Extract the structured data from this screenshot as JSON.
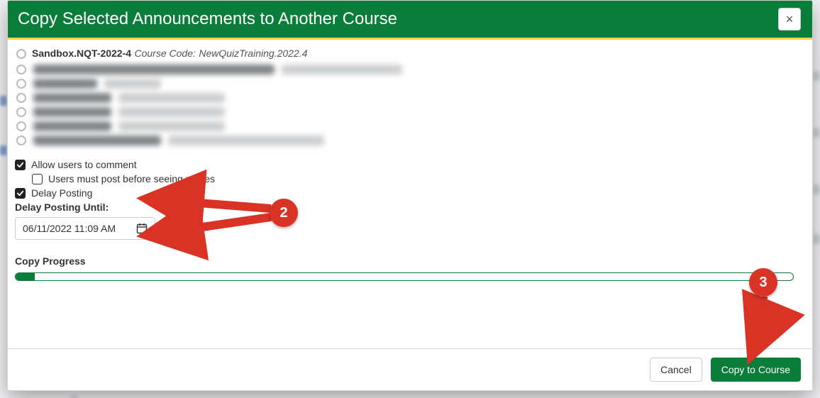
{
  "modal": {
    "title": "Copy Selected Announcements to Another Course",
    "close_symbol": "×"
  },
  "course": {
    "name": "Sandbox.NQT-2022-4",
    "code_prefix": "Course Code:",
    "code": "NewQuizTraining.2022.4"
  },
  "options": {
    "allow_comment_label": "Allow users to comment",
    "users_must_post_label": "Users must post before seeing replies",
    "delay_posting_label": "Delay Posting",
    "delay_until_label": "Delay Posting Until:",
    "delay_value": "06/11/2022 11:09 AM"
  },
  "progress": {
    "label": "Copy Progress"
  },
  "footer": {
    "cancel": "Cancel",
    "copy": "Copy to Course"
  },
  "annotations": {
    "badge2": "2",
    "badge3": "3"
  }
}
